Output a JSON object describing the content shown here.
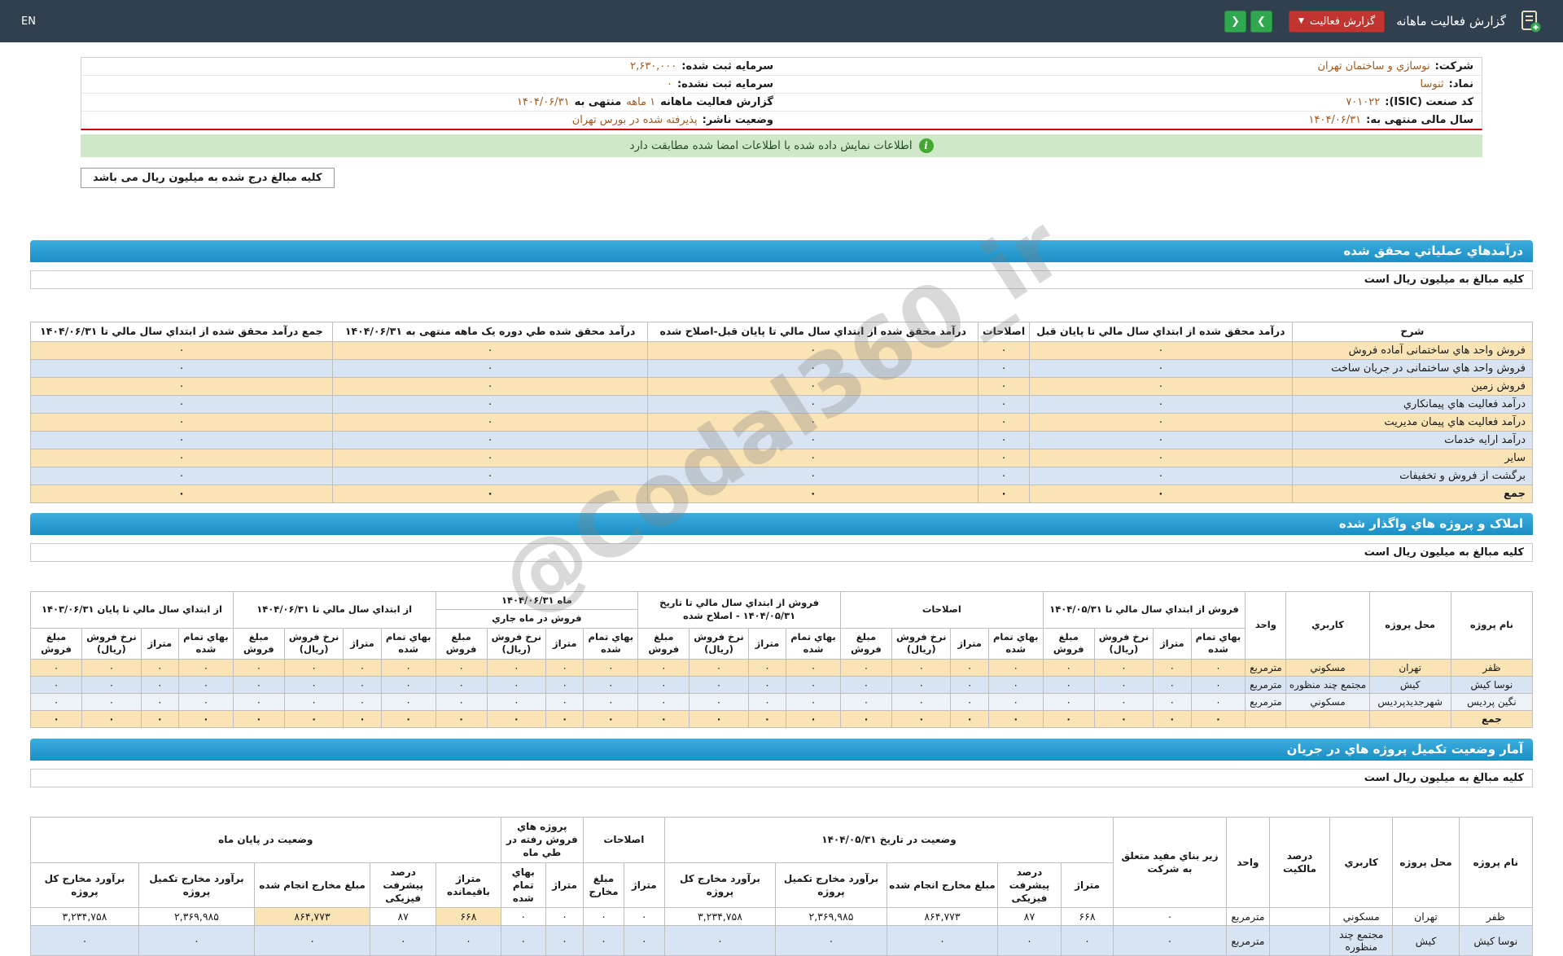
{
  "watermark": "@Codal360_ir",
  "header": {
    "en": "EN",
    "title": "گزارش فعالیت ماهانه",
    "report_button": "گزارش فعالیت",
    "caret": "▼",
    "next": "❯",
    "prev": "❮"
  },
  "info": {
    "company_label": "شرکت:",
    "company": "نوسازي و ساختمان تهران",
    "symbol_label": "نماد:",
    "symbol": "ثنوسا",
    "isic_label": "کد صنعت (ISIC):",
    "isic": "۷۰۱۰۲۲",
    "fiscal_year_label": "سال مالی منتهی به:",
    "fiscal_year": "۱۴۰۴/۰۶/۳۱",
    "registered_capital_label": "سرمایه ثبت شده:",
    "registered_capital": "۲,۶۳۰,۰۰۰",
    "unregistered_capital_label": "سرمایه ثبت نشده:",
    "unregistered_capital": "۰",
    "report_period_label": "گزارش فعالیت ماهانه",
    "report_period": "۱ ماهه",
    "period_ending_label": "منتهی به",
    "period_ending": "۱۴۰۴/۰۶/۳۱",
    "issuer_status_label": "وضعیت ناشر:",
    "issuer_status": "پذیرفته شده در بورس تهران"
  },
  "notices": {
    "signed_match": "اطلاعات نمایش داده شده با اطلاعات امضا شده مطابقت دارد",
    "info_icon": "i",
    "amounts_note": "کلیه مبالغ درج شده به میلیون ریال می باشد",
    "amounts_unit": "کلیه مبالغ به میلیون ریال است"
  },
  "revenue_section": {
    "title": "درآمدهاي عملياتي محقق شده",
    "headers": [
      "شرح",
      "درآمد محقق شده از ابتداي سال مالي تا پایان قبل",
      "اصلاحات",
      "درآمد محقق شده از ابتداي سال مالي تا پایان قبل-اصلاح شده",
      "درآمد محقق شده طي دوره یک ماهه منتهی به ۱۴۰۴/۰۶/۳۱",
      "جمع درآمد محقق شده از ابتداي سال مالي تا ۱۴۰۴/۰۶/۳۱"
    ],
    "rows": [
      [
        "فروش واحد هاي ساختمانی آماده فروش",
        "۰",
        "۰",
        "۰",
        "۰",
        "۰"
      ],
      [
        "فروش واحد هاي ساختمانی در جریان ساخت",
        "۰",
        "۰",
        "۰",
        "۰",
        "۰"
      ],
      [
        "فروش زمین",
        "۰",
        "۰",
        "۰",
        "۰",
        "۰"
      ],
      [
        "درآمد فعالیت هاي پیمانکاري",
        "۰",
        "۰",
        "۰",
        "۰",
        "۰"
      ],
      [
        "درآمد فعالیت هاي پیمان مدیریت",
        "۰",
        "۰",
        "۰",
        "۰",
        "۰"
      ],
      [
        "درآمد ارایه خدمات",
        "۰",
        "۰",
        "۰",
        "۰",
        "۰"
      ],
      [
        "سایر",
        "۰",
        "۰",
        "۰",
        "۰",
        "۰"
      ],
      [
        "برگشت از فروش و تخفیفات",
        "۰",
        "۰",
        "۰",
        "۰",
        "۰"
      ],
      [
        "جمع",
        "۰",
        "۰",
        "۰",
        "۰",
        "۰"
      ]
    ]
  },
  "sales_section": {
    "title": "املاک و پروژه هاي واگذار شده",
    "label_headers": [
      "نام پروژه",
      "محل پروژه",
      "کاربري",
      "واحد"
    ],
    "groups": [
      "فروش از ابتداي سال مالي تا ۱۴۰۴/۰۵/۳۱",
      "اصلاحات",
      "فروش از ابتداي سال مالي تا تاریخ ۱۴۰۴/۰۵/۳۱ - اصلاح شده",
      "ماه ۱۴۰۴/۰۶/۳۱",
      "از ابتداي سال مالي تا ۱۴۰۴/۰۶/۳۱",
      "از ابتداي سال مالي تا پایان ۱۴۰۳/۰۶/۳۱"
    ],
    "month_subgroup": "فروش در ماه جاري",
    "sub_headers": [
      "بهاي تمام شده",
      "متراژ",
      "نرخ فروش (ریال)",
      "مبلغ فروش"
    ],
    "rows": [
      [
        "ظفر",
        "تهران",
        "مسکوني",
        "مترمربع",
        "۰",
        "۰",
        "۰",
        "۰",
        "۰",
        "۰",
        "۰",
        "۰",
        "۰",
        "۰",
        "۰",
        "۰",
        "۰",
        "۰",
        "۰",
        "۰",
        "۰",
        "۰",
        "۰",
        "۰",
        "۰",
        "۰",
        "۰",
        "۰"
      ],
      [
        "نوسا کیش",
        "کیش",
        "مجتمع چند منظوره",
        "مترمربع",
        "۰",
        "۰",
        "۰",
        "۰",
        "۰",
        "۰",
        "۰",
        "۰",
        "۰",
        "۰",
        "۰",
        "۰",
        "۰",
        "۰",
        "۰",
        "۰",
        "۰",
        "۰",
        "۰",
        "۰",
        "۰",
        "۰",
        "۰",
        "۰"
      ],
      [
        "نگین پردیس",
        "شهرجدیدپردیس",
        "مسکوني",
        "مترمربع",
        "۰",
        "۰",
        "۰",
        "۰",
        "۰",
        "۰",
        "۰",
        "۰",
        "۰",
        "۰",
        "۰",
        "۰",
        "۰",
        "۰",
        "۰",
        "۰",
        "۰",
        "۰",
        "۰",
        "۰",
        "۰",
        "۰",
        "۰",
        "۰"
      ],
      [
        "جمع",
        "",
        "",
        "",
        "۰",
        "۰",
        "۰",
        "۰",
        "۰",
        "۰",
        "۰",
        "۰",
        "۰",
        "۰",
        "۰",
        "۰",
        "۰",
        "۰",
        "۰",
        "۰",
        "۰",
        "۰",
        "۰",
        "۰",
        "۰",
        "۰",
        "۰",
        "۰"
      ]
    ]
  },
  "progress_section": {
    "title": "آمار وضعیت تکمیل پروژه هاي در جریان",
    "label_headers": [
      "نام پروژه",
      "محل پروژه",
      "کاربري",
      "درصد مالکیت",
      "واحد",
      "زیر بناي مفید متعلق به شرکت"
    ],
    "groups": [
      "وضعیت در تاریخ ۱۴۰۴/۰۵/۳۱",
      "اصلاحات",
      "پروژه هاي فروش رفته در طي ماه",
      "وضعیت در پایان ماه"
    ],
    "g1_subs": [
      "متراژ",
      "درصد پیشرفت فیزیکی",
      "مبلغ مخارج انجام شده",
      "برآورد مخارج تکمیل پروژه",
      "برآورد مخارج کل پروژه"
    ],
    "g2_subs": [
      "متراژ",
      "مبلغ مخارج"
    ],
    "g3_subs": [
      "متراژ",
      "بهاي تمام شده"
    ],
    "g4_subs": [
      "متراژ باقیمانده",
      "درصد پیشرفت فیزیکی",
      "مبلغ مخارج انجام شده",
      "برآورد مخارج تکمیل پروژه",
      "برآورد مخارج کل پروژه"
    ],
    "rows": [
      [
        "ظفر",
        "تهران",
        "مسکوني",
        "",
        "مترمربع",
        "۰",
        "۶۶۸",
        "۸۷",
        "۸۶۴,۷۷۳",
        "۲,۳۶۹,۹۸۵",
        "۳,۲۳۴,۷۵۸",
        "۰",
        "۰",
        "۰",
        "۰",
        "۶۶۸",
        "۸۷",
        "۸۶۴,۷۷۳",
        "۲,۳۶۹,۹۸۵",
        "۳,۲۳۴,۷۵۸"
      ],
      [
        "نوسا کیش",
        "کیش",
        "مجتمع چند منظوره",
        "",
        "مترمربع",
        "۰",
        "۰",
        "۰",
        "۰",
        "۰",
        "۰",
        "۰",
        "۰",
        "۰",
        "۰",
        "۰",
        "۰",
        "۰",
        "۰",
        "۰"
      ]
    ]
  }
}
